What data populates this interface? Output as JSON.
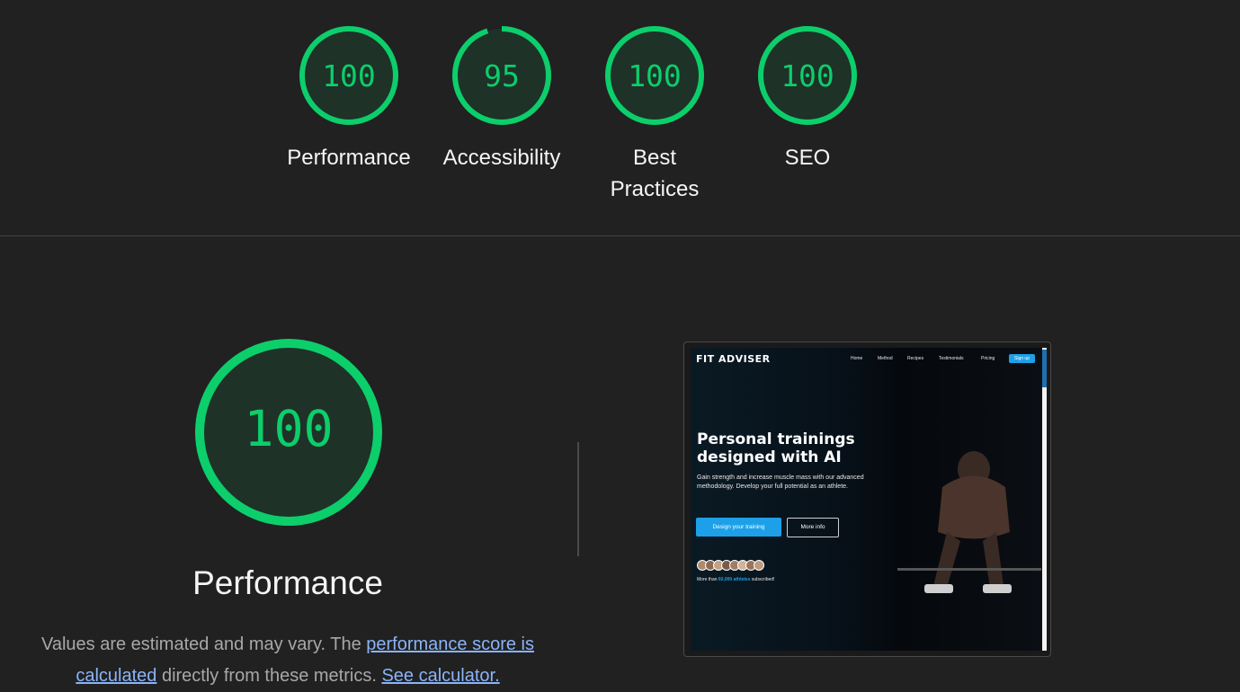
{
  "colors": {
    "background": "#212121",
    "pass": "#0cce6b",
    "text": "#f5f5f5",
    "link": "#8ab4f8",
    "accent": "#1ea0e8"
  },
  "gauges": [
    {
      "score": "100",
      "label_lines": [
        "Performance"
      ],
      "fraction": 1.0
    },
    {
      "score": "95",
      "label_lines": [
        "Accessibility"
      ],
      "fraction": 0.95
    },
    {
      "score": "100",
      "label_lines": [
        "Best",
        "Practices"
      ],
      "fraction": 1.0
    },
    {
      "score": "100",
      "label_lines": [
        "SEO"
      ],
      "fraction": 1.0
    }
  ],
  "performance": {
    "score": "100",
    "fraction": 1.0,
    "title": "Performance",
    "desc_prefix": "Values are estimated and may vary. The ",
    "desc_link1": "performance score is calculated",
    "desc_middle": " directly from these metrics. ",
    "desc_link2": "See calculator."
  },
  "thumbnail": {
    "logo": "FIT ADVISER",
    "nav": [
      "Home",
      "Method",
      "Recipes",
      "Testimonials",
      "Pricing"
    ],
    "signup": "Sign up",
    "headline_lines": [
      "Personal trainings",
      "designed with AI"
    ],
    "subtitle": "Gain strength and increase muscle mass with our advanced methodology. Develop your full potential as an athlete.",
    "btn_primary": "Design your training",
    "btn_secondary": "More info",
    "subscribed_prefix": "More than ",
    "subscribed_count": "60,000 athletes",
    "subscribed_suffix": " subscribed!"
  }
}
